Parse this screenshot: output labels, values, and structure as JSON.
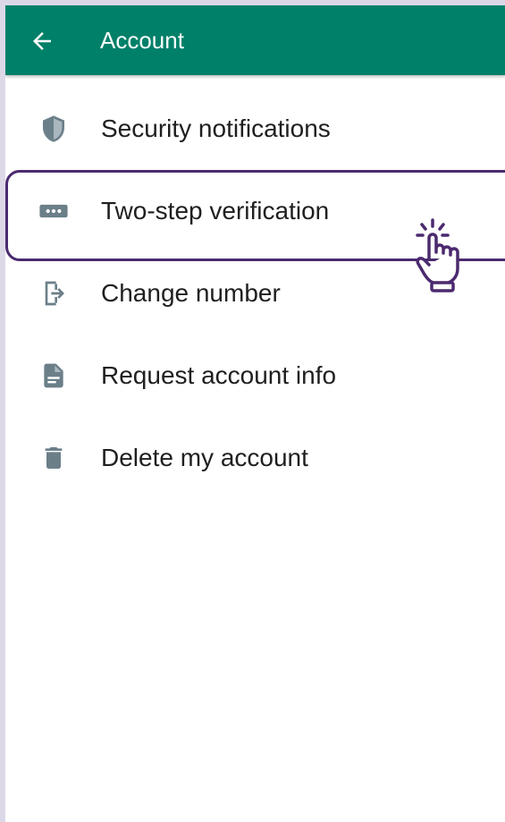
{
  "appbar": {
    "title": "Account",
    "back_icon": "arrow-left-icon",
    "color": "#008069"
  },
  "menu": {
    "items": [
      {
        "label": "Security notifications",
        "icon": "shield-icon"
      },
      {
        "label": "Two-step verification",
        "icon": "password-dots-icon"
      },
      {
        "label": "Change number",
        "icon": "phone-exit-icon"
      },
      {
        "label": "Request account info",
        "icon": "document-icon"
      },
      {
        "label": "Delete my account",
        "icon": "trash-icon"
      }
    ]
  },
  "annotation": {
    "highlighted_item": "Two-step verification",
    "pointer_icon": "tap-hand-icon",
    "highlight_color": "#4b2a6f"
  }
}
